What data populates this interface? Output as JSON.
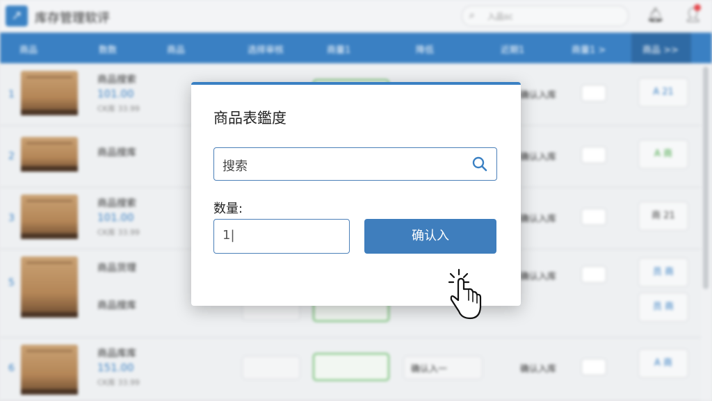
{
  "app": {
    "title": "库存管理软评",
    "search_placeholder": "入品sc"
  },
  "table": {
    "headers": [
      "商品",
      "数数",
      "商品",
      "选择审核",
      "商量1",
      "降低",
      "近期1",
      "商量1 >",
      "商品 >>"
    ]
  },
  "rows": [
    {
      "index": "1",
      "name": "商品搜索",
      "price": "101.00",
      "stock": "CK库 33.99",
      "cell_a": "",
      "cell_b": "",
      "action": "确认入库",
      "grade": "A 21"
    },
    {
      "index": "2",
      "name": "商品搜库",
      "price": "",
      "stock": "",
      "cell_a": "",
      "cell_b": "",
      "action": "确认入库",
      "grade": "A 商"
    },
    {
      "index": "3",
      "name": "商品搜索",
      "price": "101.00",
      "stock": "CK库 33.99",
      "cell_a": "",
      "cell_b": "",
      "action": "确认入库",
      "grade": "商 21"
    },
    {
      "index": "5",
      "name": "商品货理",
      "price": "",
      "stock": "",
      "cell_a": "",
      "cell_b": "",
      "action": "确认入库",
      "grade": "员 商"
    },
    {
      "index": "6",
      "name": "商品库库",
      "price": "151.00",
      "stock": "CK库 33.99",
      "cell_a": "",
      "cell_b": "确认入一",
      "action": "确认入库",
      "grade": "A 商"
    }
  ],
  "modal": {
    "title": "商品表鑑度",
    "search_value": "搜索",
    "qty_label": "数量:",
    "qty_value": "1|",
    "confirm_label": "确认入"
  }
}
